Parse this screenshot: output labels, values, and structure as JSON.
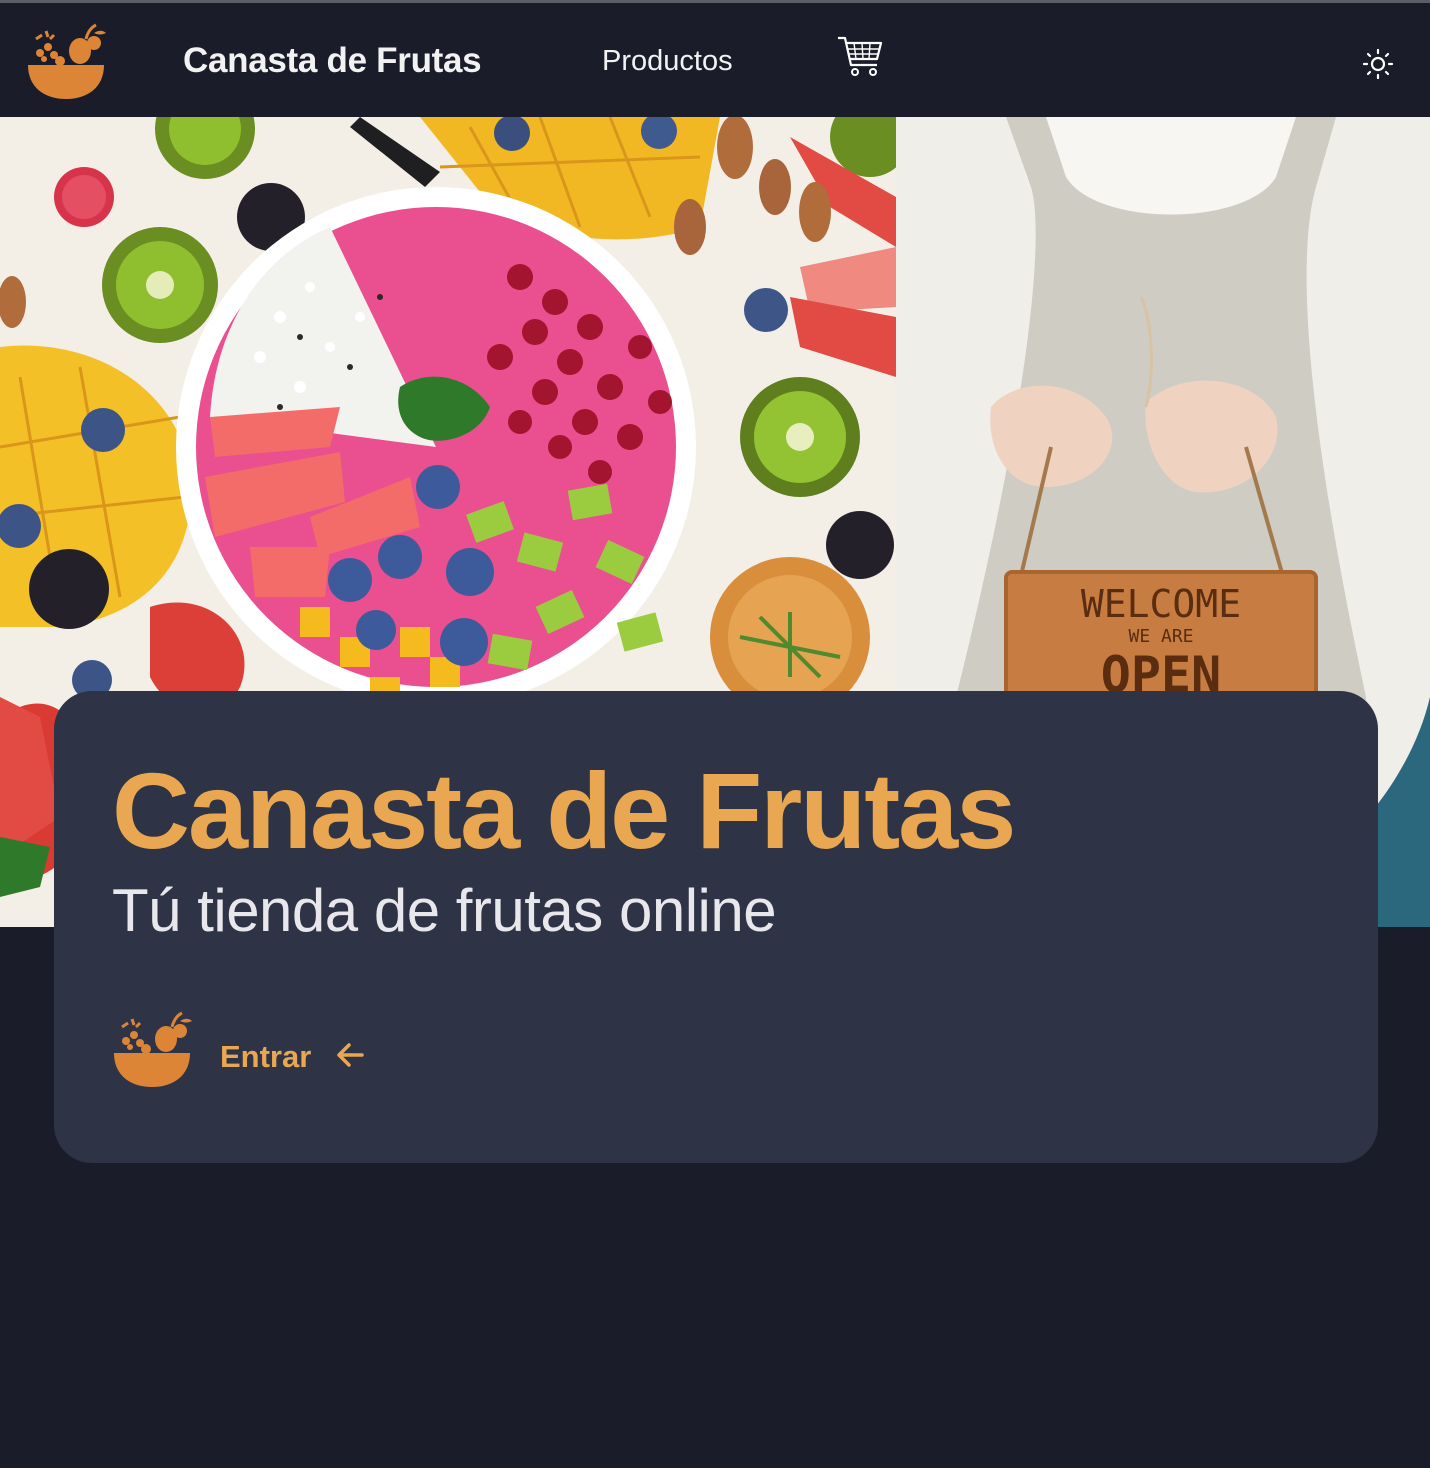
{
  "navbar": {
    "logo_icon": "fruit-basket-icon",
    "brand": "Canasta de Frutas",
    "products_link": "Productos",
    "cart_icon": "shopping-cart-icon",
    "theme_icon": "sun-icon"
  },
  "hero": {
    "left_image": "fruit-bowl-photo",
    "right_image": "welcome-open-sign-photo",
    "sign_lines": [
      "WELCOME",
      "WE ARE",
      "OPEN"
    ]
  },
  "card": {
    "title": "Canasta de Frutas",
    "subtitle": "Tú tienda de frutas online",
    "enter_label": "Entrar",
    "enter_icon": "fruit-basket-icon",
    "arrow_icon": "arrow-left-icon"
  },
  "colors": {
    "background": "#1a1d29",
    "card": "#2e3446",
    "accent": "#e9a752",
    "logo_orange": "#dd8537",
    "text": "#f2f2f2"
  }
}
